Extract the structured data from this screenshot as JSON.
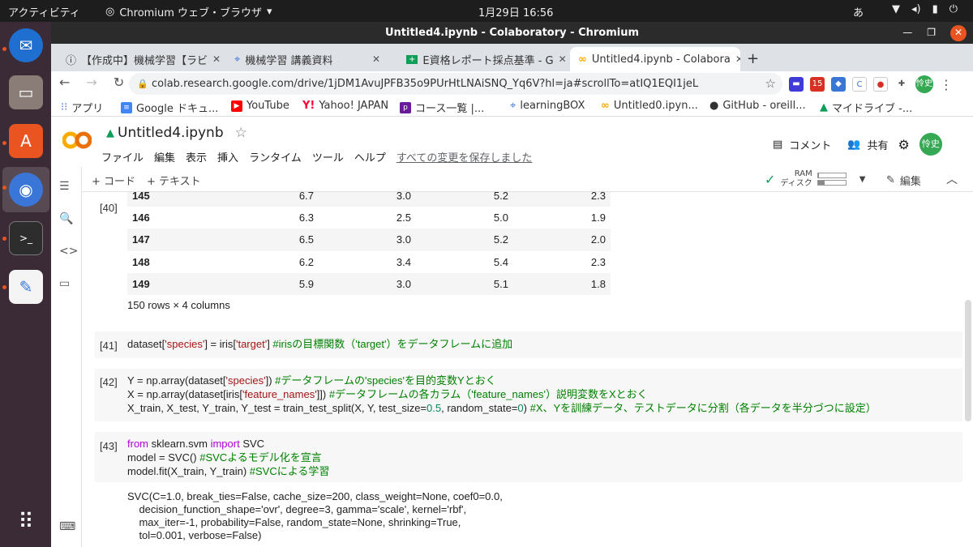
{
  "os": {
    "activities": "アクティビティ",
    "app_menu": "Chromium ウェブ・ブラウザ",
    "clock": "1月29日  16:56",
    "ime": "あ"
  },
  "window": {
    "title": "Untitled4.ipynb - Colaboratory - Chromium"
  },
  "tabs": [
    {
      "label": "【作成中】機械学習【ラビ"
    },
    {
      "label": "機械学習 講義資料"
    },
    {
      "label": "E資格レポート採点基準 - G"
    },
    {
      "label": "Untitled4.ipynb - Colabora"
    }
  ],
  "url": "colab.research.google.com/drive/1jDM1AvuJPFB35o9PUrHtLNAiSNQ_Yq6V?hl=ja#scrollTo=atIQ1EQI1jeL",
  "bookmarks": [
    {
      "label": "アプリ"
    },
    {
      "label": "Google ドキュ..."
    },
    {
      "label": "YouTube"
    },
    {
      "label": "Yahoo! JAPAN"
    },
    {
      "label": "コース一覧 |..."
    },
    {
      "label": "learningBOX"
    },
    {
      "label": "Untitled0.ipyn..."
    },
    {
      "label": "GitHub - oreill..."
    },
    {
      "label": "マイドライブ -..."
    }
  ],
  "colab": {
    "filename": "Untitled4.ipynb",
    "menus": [
      "ファイル",
      "編集",
      "表示",
      "挿入",
      "ランタイム",
      "ツール",
      "ヘルプ"
    ],
    "saved_status": "すべての変更を保存しました",
    "comment": "コメント",
    "share": "共有",
    "avatar": "怜史",
    "add_code": "+ コード",
    "add_text": "+ テキスト",
    "ram": "RAM",
    "disk": "ディスク",
    "ram_usage": 0.05,
    "disk_usage": 0.25,
    "edit": "編集"
  },
  "cells": {
    "c40": {
      "prompt": "[40]",
      "rows": [
        [
          "145",
          "6.7",
          "3.0",
          "5.2",
          "2.3"
        ],
        [
          "146",
          "6.3",
          "2.5",
          "5.0",
          "1.9"
        ],
        [
          "147",
          "6.5",
          "3.0",
          "5.2",
          "2.0"
        ],
        [
          "148",
          "6.2",
          "3.4",
          "5.4",
          "2.3"
        ],
        [
          "149",
          "5.9",
          "3.0",
          "5.1",
          "1.8"
        ]
      ],
      "shape": "150 rows × 4 columns"
    },
    "c41": {
      "prompt": "[41]",
      "a": "dataset[",
      "b": "'species'",
      "c": "] = iris[",
      "d": "'target'",
      "e": "] ",
      "comment": "#irisの目標関数（'target'）をデータフレームに追加"
    },
    "c42": {
      "prompt": "[42]",
      "l1a": "Y = np.array(dataset[",
      "l1b": "'species'",
      "l1c": "]) ",
      "l1comment": "#データフレームの'species'を目的変数Yとおく",
      "l2a": "X = np.array(dataset[iris[",
      "l2b": "'feature_names'",
      "l2c": "]]) ",
      "l2comment": "#データフレームの各カラム（'feature_names'）説明変数をXとおく",
      "l3a": "X_train, X_test, Y_train, Y_test = train_test_split(X, Y, test_size=",
      "l3b": "0.5",
      "l3c": ", random_state=",
      "l3d": "0",
      "l3e": ") ",
      "l3comment": "#X、Yを訓練データ、テストデータに分割（各データを半分づつに設定）"
    },
    "c43": {
      "prompt": "[43]",
      "kw_from": "from",
      "mod": " sklearn.svm ",
      "kw_import": "import",
      "cls": " SVC",
      "l2a": "model = SVC() ",
      "l2comment": "#SVCよるモデル化を宣言",
      "l3a": "model.fit(X_train, Y_train) ",
      "l3comment": "#SVCによる学習",
      "output": "SVC(C=1.0, break_ties=False, cache_size=200, class_weight=None, coef0=0.0,\n    decision_function_shape='ovr', degree=3, gamma='scale', kernel='rbf',\n    max_iter=-1, probability=False, random_state=None, shrinking=True,\n    tol=0.001, verbose=False)"
    }
  }
}
